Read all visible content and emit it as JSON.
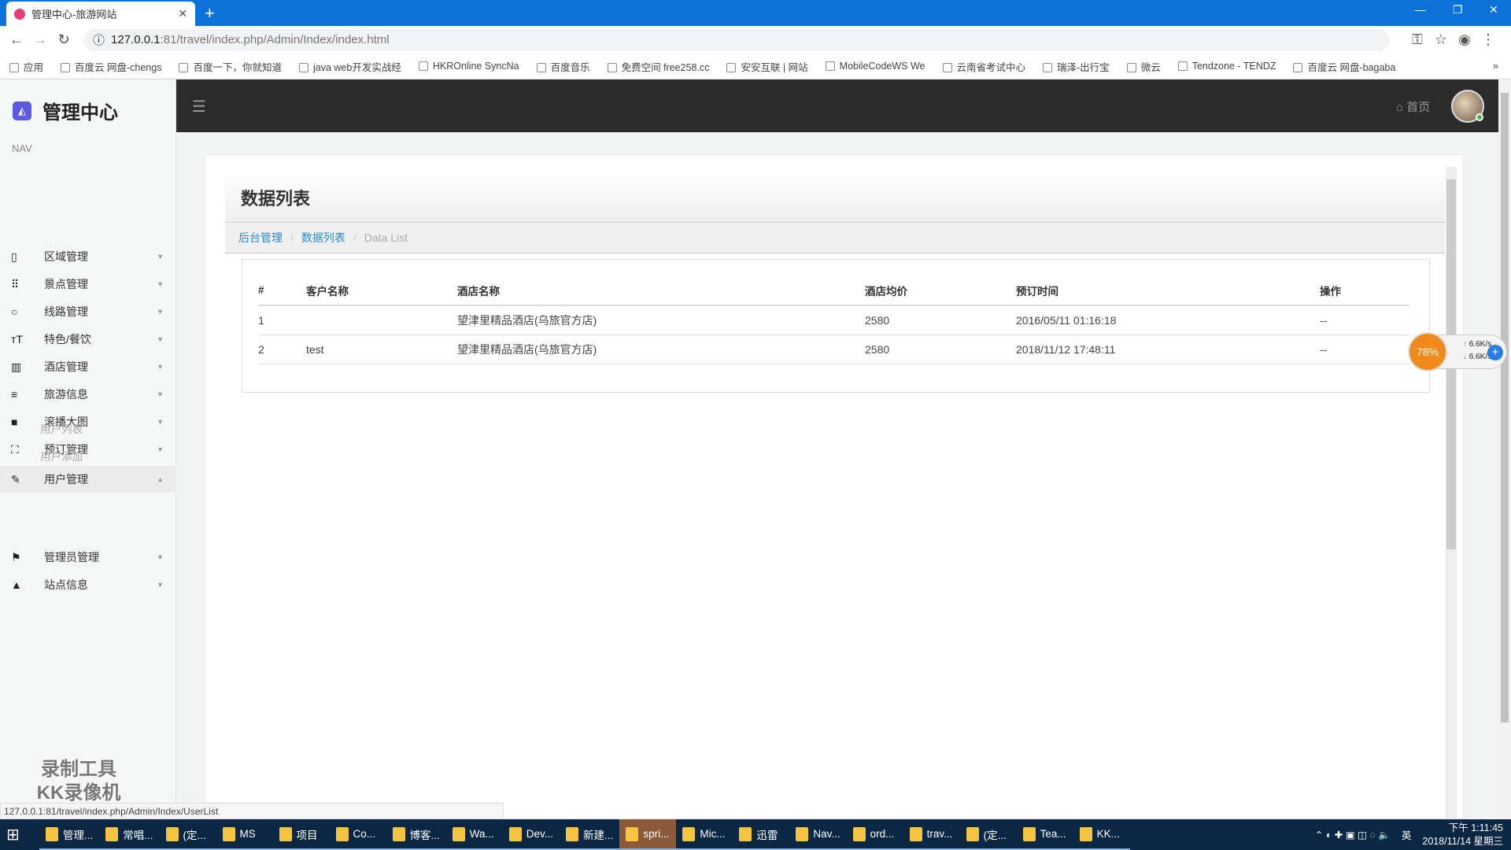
{
  "browser": {
    "tab_title": "管理中心-旅游网站",
    "url_host": "127.0.0.1",
    "url_port": ":81",
    "url_path": "/travel/index.php/Admin/Index/index.html",
    "bookmarks": [
      "应用",
      "百度云 网盘-chengs",
      "百度一下，你就知道",
      "java web开发实战经",
      "HKROnline SyncNa",
      "百度音乐",
      "免费空间 free258.cc",
      "安安互联 | 网站",
      "MobileCodeWS We",
      "云南省考试中心",
      "瑞泽-出行宝",
      "微云",
      "Tendzone - TENDZ",
      "百度云 网盘-bagaba"
    ],
    "status_url": "127.0.0.1:81/travel/index.php/Admin/Index/UserList"
  },
  "sidebar": {
    "title": "管理中心",
    "nav_label": "NAV",
    "items": [
      {
        "label": "区域管理",
        "icon": "tablet-icon"
      },
      {
        "label": "景点管理",
        "icon": "grid-icon"
      },
      {
        "label": "线路管理",
        "icon": "circle-icon"
      },
      {
        "label": "特色/餐饮",
        "icon": "text-size-icon"
      },
      {
        "label": "酒店管理",
        "icon": "map-icon"
      },
      {
        "label": "旅游信息",
        "icon": "filter-icon"
      },
      {
        "label": "滚播大图",
        "icon": "book-icon"
      },
      {
        "label": "预订管理",
        "icon": "expand-icon"
      },
      {
        "label": "用户管理",
        "icon": "pencil-icon"
      },
      {
        "label": "管理员管理",
        "icon": "flag-icon"
      },
      {
        "label": "站点信息",
        "icon": "mountain-icon"
      }
    ],
    "subitems": [
      "用户列表",
      "用户添加"
    ],
    "watermark": "录制工具 KK录像机"
  },
  "header": {
    "home": "首页"
  },
  "page": {
    "title": "数据列表",
    "breadcrumb": [
      "后台管理",
      "数据列表",
      "Data List"
    ],
    "columns": [
      "#",
      "客户名称",
      "酒店名称",
      "酒店均价",
      "预订时间",
      "操作"
    ],
    "rows": [
      [
        "1",
        "",
        "望津里精品酒店(乌旅官方店)",
        "2580",
        "2016/05/11 01:16:18",
        "--"
      ],
      [
        "2",
        "test",
        "望津里精品酒店(乌旅官方店)",
        "2580",
        "2018/11/12 17:48:11",
        "--"
      ]
    ]
  },
  "net_widget": {
    "percent": "78%",
    "up": "6.6K/s",
    "down": "6.6K/s"
  },
  "taskbar": {
    "items": [
      "管理...",
      "常唱...",
      "(定...",
      "MS",
      "项目",
      "Co...",
      "博客...",
      "Wa...",
      "Dev...",
      "新建...",
      "spri...",
      "Mic...",
      "迅雷",
      "Nav...",
      "ord...",
      "trav...",
      "(定...",
      "Tea...",
      "KK..."
    ],
    "ime": "英",
    "time": "下午 1:11:45",
    "date": "2018/11/14 星期三"
  }
}
